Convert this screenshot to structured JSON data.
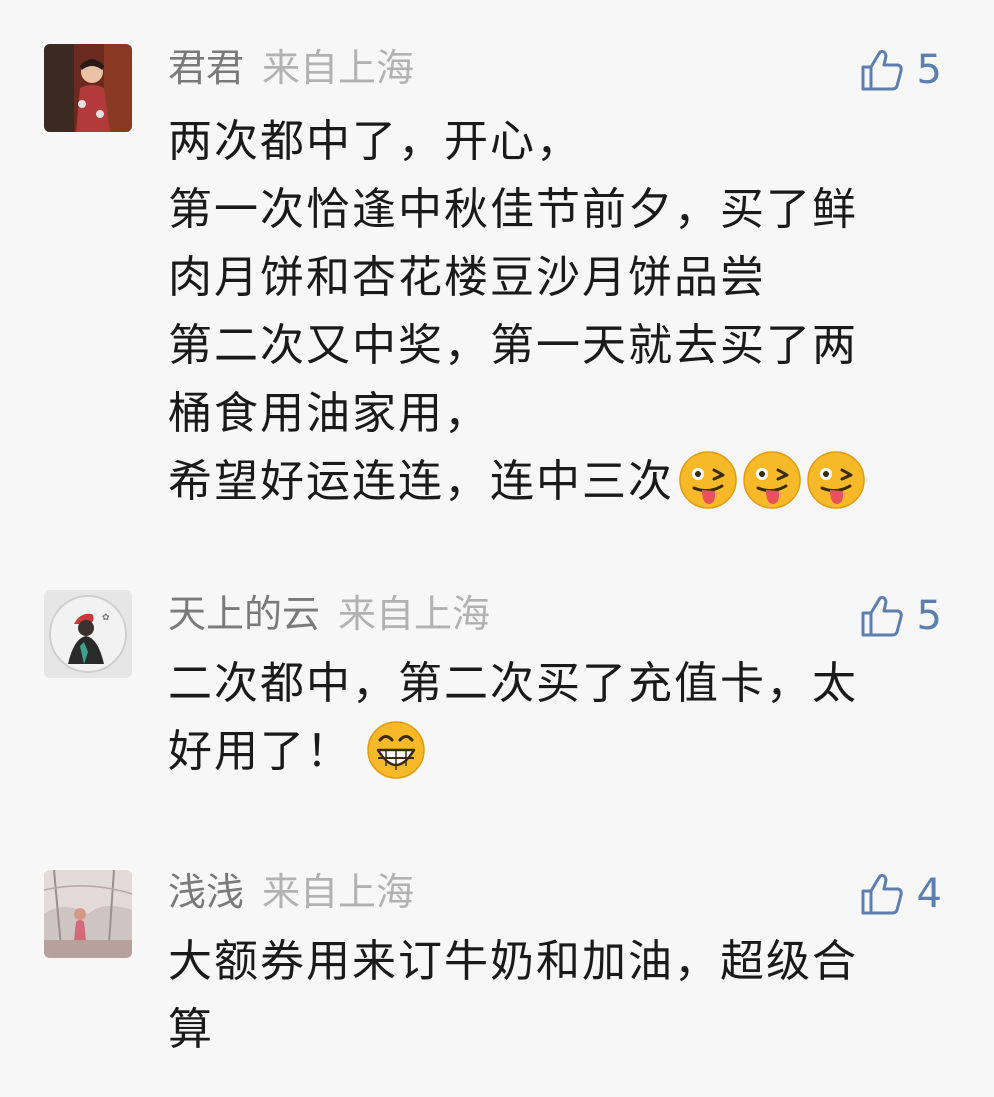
{
  "comments": [
    {
      "username": "君君",
      "location": "来自上海",
      "likes": "5",
      "lines": [
        "两次都中了，开心，",
        "第一次恰逢中秋佳节前夕，买了鲜",
        "肉月饼和杏花楼豆沙月饼品尝",
        "第二次又中奖，第一天就去买了两",
        "桶食用油家用，",
        "希望好运连连，连中三次"
      ],
      "emojis": [
        "wink-tongue-emoji",
        "wink-tongue-emoji",
        "wink-tongue-emoji"
      ]
    },
    {
      "username": "天上的云",
      "location": "来自上海",
      "likes": "5",
      "lines": [
        "二次都中，第二次买了充值卡，太",
        "好用了！"
      ],
      "emojis": [
        "grin-emoji"
      ]
    },
    {
      "username": "浅浅",
      "location": "来自上海",
      "likes": "4",
      "lines": [
        "大额券用来订牛奶和加油，超级合",
        "算"
      ],
      "emojis": []
    }
  ],
  "colors": {
    "background": "#f7f7f7",
    "username": "#7a7a7a",
    "location": "#b2b2b2",
    "like_accent": "#5d7fb0",
    "body_text": "#1a1a1a"
  },
  "icons": {
    "like": "thumbs-up-icon"
  }
}
